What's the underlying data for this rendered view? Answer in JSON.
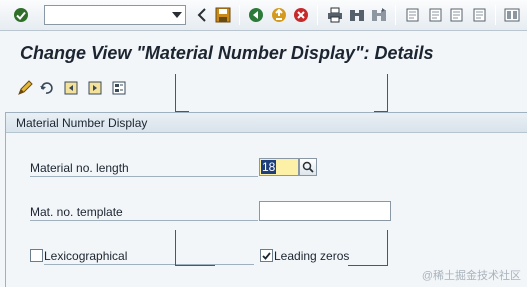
{
  "toolbar": {
    "command_field_value": "",
    "icons": [
      "enter-icon",
      "back-icon",
      "exit-icon",
      "cancel-icon",
      "print-icon",
      "find-icon",
      "find-next-icon",
      "first-page-icon",
      "previous-page-icon",
      "next-page-icon",
      "last-page-icon",
      "save-icon"
    ]
  },
  "title": "Change View \"Material Number Display\": Details",
  "app_toolbar": {
    "icons": [
      "display-change-icon",
      "undo-icon",
      "previous-entry-icon",
      "next-entry-icon",
      "variable-list-icon"
    ]
  },
  "frame": {
    "title": "Material Number Display",
    "material_length_label": "Material no. length",
    "material_length_value": "18",
    "template_label": "Mat. no. template",
    "template_value": "",
    "lexicographical_label": "Lexicographical",
    "lexicographical_checked": false,
    "leading_zeros_label": "Leading zeros",
    "leading_zeros_checked": true
  },
  "watermark": "@稀土掘金技术社区",
  "colors": {
    "background": "#f2f6f9",
    "input_highlight": "#fdf1a8",
    "selection": "#1f3f7a",
    "marker_red": "#c0282d"
  }
}
